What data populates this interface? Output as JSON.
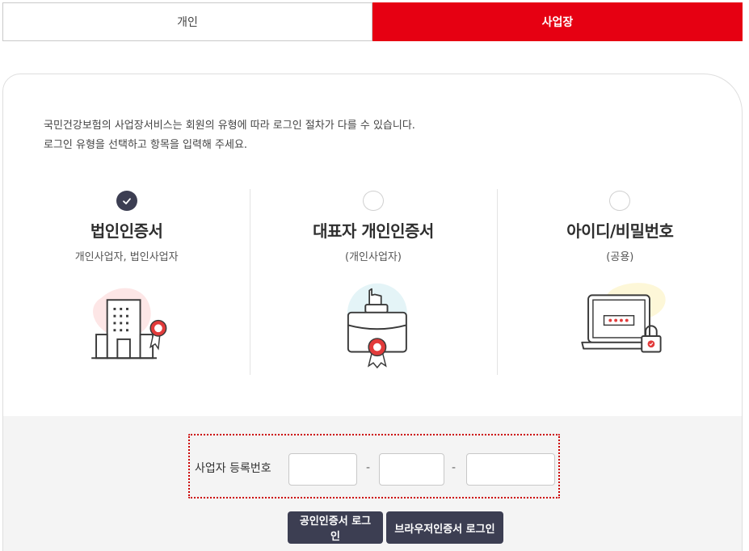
{
  "tabs": [
    {
      "label": "개인",
      "active": false
    },
    {
      "label": "사업장",
      "active": true
    }
  ],
  "intro": {
    "line1": "국민건강보험의 사업장서비스는 회원의 유형에 따라 로그인 절차가 다를 수 있습니다.",
    "line2": "로그인 유형을 선택하고 항목을 입력해 주세요."
  },
  "login_types": [
    {
      "title": "법인인증서",
      "subtitle": "개인사업자, 법인사업자",
      "selected": true,
      "icon": "building-icon"
    },
    {
      "title": "대표자 개인인증서",
      "subtitle": "(개인사업자)",
      "selected": false,
      "icon": "briefcase-icon"
    },
    {
      "title": "아이디/비밀번호",
      "subtitle": "(공용)",
      "selected": false,
      "icon": "laptop-lock-icon"
    }
  ],
  "form": {
    "business_number_label": "사업자 등록번호",
    "field1_value": "",
    "field2_value": "",
    "field3_value": "",
    "separator": "-"
  },
  "buttons": {
    "cert_login": "공인인증서 로그인",
    "browser_cert_login": "브라우저인증서 로그인"
  },
  "colors": {
    "accent_red": "#e60012",
    "dark_navy": "#3c3e52",
    "highlight_border": "#cc0000"
  }
}
